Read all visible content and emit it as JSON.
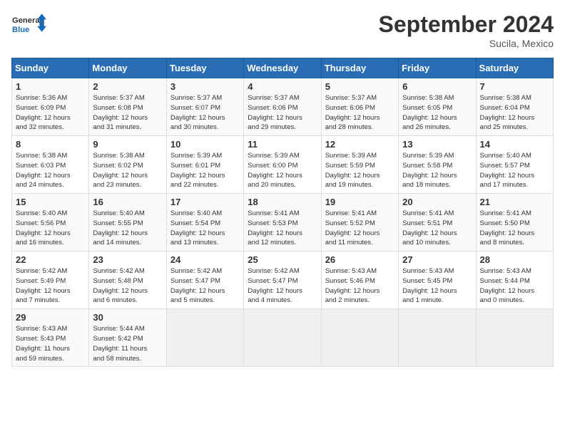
{
  "logo": {
    "line1": "General",
    "line2": "Blue"
  },
  "title": "September 2024",
  "subtitle": "Sucila, Mexico",
  "days_of_week": [
    "Sunday",
    "Monday",
    "Tuesday",
    "Wednesday",
    "Thursday",
    "Friday",
    "Saturday"
  ],
  "weeks": [
    [
      {
        "day": "1",
        "info": "Sunrise: 5:36 AM\nSunset: 6:09 PM\nDaylight: 12 hours\nand 32 minutes."
      },
      {
        "day": "2",
        "info": "Sunrise: 5:37 AM\nSunset: 6:08 PM\nDaylight: 12 hours\nand 31 minutes."
      },
      {
        "day": "3",
        "info": "Sunrise: 5:37 AM\nSunset: 6:07 PM\nDaylight: 12 hours\nand 30 minutes."
      },
      {
        "day": "4",
        "info": "Sunrise: 5:37 AM\nSunset: 6:06 PM\nDaylight: 12 hours\nand 29 minutes."
      },
      {
        "day": "5",
        "info": "Sunrise: 5:37 AM\nSunset: 6:06 PM\nDaylight: 12 hours\nand 28 minutes."
      },
      {
        "day": "6",
        "info": "Sunrise: 5:38 AM\nSunset: 6:05 PM\nDaylight: 12 hours\nand 26 minutes."
      },
      {
        "day": "7",
        "info": "Sunrise: 5:38 AM\nSunset: 6:04 PM\nDaylight: 12 hours\nand 25 minutes."
      }
    ],
    [
      {
        "day": "8",
        "info": "Sunrise: 5:38 AM\nSunset: 6:03 PM\nDaylight: 12 hours\nand 24 minutes."
      },
      {
        "day": "9",
        "info": "Sunrise: 5:38 AM\nSunset: 6:02 PM\nDaylight: 12 hours\nand 23 minutes."
      },
      {
        "day": "10",
        "info": "Sunrise: 5:39 AM\nSunset: 6:01 PM\nDaylight: 12 hours\nand 22 minutes."
      },
      {
        "day": "11",
        "info": "Sunrise: 5:39 AM\nSunset: 6:00 PM\nDaylight: 12 hours\nand 20 minutes."
      },
      {
        "day": "12",
        "info": "Sunrise: 5:39 AM\nSunset: 5:59 PM\nDaylight: 12 hours\nand 19 minutes."
      },
      {
        "day": "13",
        "info": "Sunrise: 5:39 AM\nSunset: 5:58 PM\nDaylight: 12 hours\nand 18 minutes."
      },
      {
        "day": "14",
        "info": "Sunrise: 5:40 AM\nSunset: 5:57 PM\nDaylight: 12 hours\nand 17 minutes."
      }
    ],
    [
      {
        "day": "15",
        "info": "Sunrise: 5:40 AM\nSunset: 5:56 PM\nDaylight: 12 hours\nand 16 minutes."
      },
      {
        "day": "16",
        "info": "Sunrise: 5:40 AM\nSunset: 5:55 PM\nDaylight: 12 hours\nand 14 minutes."
      },
      {
        "day": "17",
        "info": "Sunrise: 5:40 AM\nSunset: 5:54 PM\nDaylight: 12 hours\nand 13 minutes."
      },
      {
        "day": "18",
        "info": "Sunrise: 5:41 AM\nSunset: 5:53 PM\nDaylight: 12 hours\nand 12 minutes."
      },
      {
        "day": "19",
        "info": "Sunrise: 5:41 AM\nSunset: 5:52 PM\nDaylight: 12 hours\nand 11 minutes."
      },
      {
        "day": "20",
        "info": "Sunrise: 5:41 AM\nSunset: 5:51 PM\nDaylight: 12 hours\nand 10 minutes."
      },
      {
        "day": "21",
        "info": "Sunrise: 5:41 AM\nSunset: 5:50 PM\nDaylight: 12 hours\nand 8 minutes."
      }
    ],
    [
      {
        "day": "22",
        "info": "Sunrise: 5:42 AM\nSunset: 5:49 PM\nDaylight: 12 hours\nand 7 minutes."
      },
      {
        "day": "23",
        "info": "Sunrise: 5:42 AM\nSunset: 5:48 PM\nDaylight: 12 hours\nand 6 minutes."
      },
      {
        "day": "24",
        "info": "Sunrise: 5:42 AM\nSunset: 5:47 PM\nDaylight: 12 hours\nand 5 minutes."
      },
      {
        "day": "25",
        "info": "Sunrise: 5:42 AM\nSunset: 5:47 PM\nDaylight: 12 hours\nand 4 minutes."
      },
      {
        "day": "26",
        "info": "Sunrise: 5:43 AM\nSunset: 5:46 PM\nDaylight: 12 hours\nand 2 minutes."
      },
      {
        "day": "27",
        "info": "Sunrise: 5:43 AM\nSunset: 5:45 PM\nDaylight: 12 hours\nand 1 minute."
      },
      {
        "day": "28",
        "info": "Sunrise: 5:43 AM\nSunset: 5:44 PM\nDaylight: 12 hours\nand 0 minutes."
      }
    ],
    [
      {
        "day": "29",
        "info": "Sunrise: 5:43 AM\nSunset: 5:43 PM\nDaylight: 11 hours\nand 59 minutes."
      },
      {
        "day": "30",
        "info": "Sunrise: 5:44 AM\nSunset: 5:42 PM\nDaylight: 11 hours\nand 58 minutes."
      },
      {
        "day": "",
        "info": ""
      },
      {
        "day": "",
        "info": ""
      },
      {
        "day": "",
        "info": ""
      },
      {
        "day": "",
        "info": ""
      },
      {
        "day": "",
        "info": ""
      }
    ]
  ]
}
